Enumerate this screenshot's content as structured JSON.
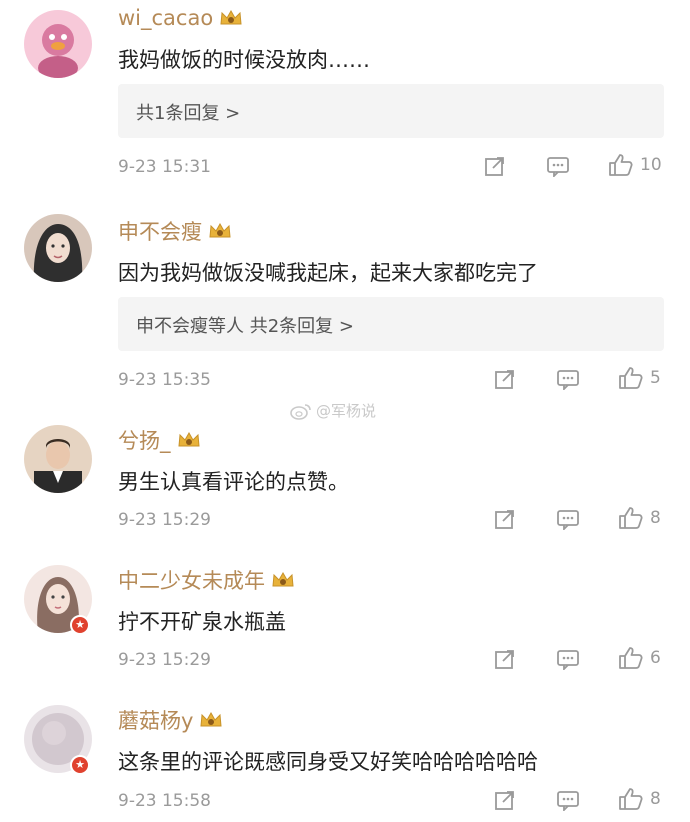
{
  "comments": [
    {
      "username": "wi_cacao",
      "text": "我妈做饭的时候没放肉……",
      "reply_summary": "共1条回复 >",
      "timestamp": "9-23 15:31",
      "likes": "10",
      "verified": false,
      "avatar_colors": [
        "#d97aa0",
        "#f7c9d9"
      ]
    },
    {
      "username": "申不会瘦",
      "text": "因为我妈做饭没喊我起床，起来大家都吃完了",
      "reply_summary": "申不会瘦等人  共2条回复 >",
      "timestamp": "9-23 15:35",
      "likes": "5",
      "verified": false,
      "avatar_colors": [
        "#3a3a3a",
        "#d8c7bb"
      ]
    },
    {
      "username": "兮扬_",
      "text": "男生认真看评论的点赞。",
      "reply_summary": "",
      "timestamp": "9-23 15:29",
      "likes": "8",
      "verified": false,
      "avatar_colors": [
        "#6b6b6b",
        "#e6d4c2"
      ]
    },
    {
      "username": "中二少女未成年",
      "text": "拧不开矿泉水瓶盖",
      "reply_summary": "",
      "timestamp": "9-23 15:29",
      "likes": "6",
      "verified": true,
      "avatar_colors": [
        "#8a6d62",
        "#f3e6e2"
      ]
    },
    {
      "username": "蘑菇杨y",
      "text": "这条里的评论既感同身受又好笑哈哈哈哈哈哈",
      "reply_summary": "",
      "timestamp": "9-23 15:58",
      "likes": "8",
      "verified": true,
      "avatar_colors": [
        "#c7bcc4",
        "#e9e3e7"
      ]
    }
  ],
  "watermark": "@军杨说",
  "icons": {
    "share": "share-icon",
    "comment": "comment-icon",
    "like": "thumbs-up-icon",
    "crown": "crown-icon",
    "verified": "verified-icon",
    "weibo": "weibo-icon"
  },
  "colors": {
    "username": "#b58a57",
    "meta": "#9a9a9a",
    "reply_bg": "#f4f4f4",
    "verified_badge": "#e0422f"
  }
}
